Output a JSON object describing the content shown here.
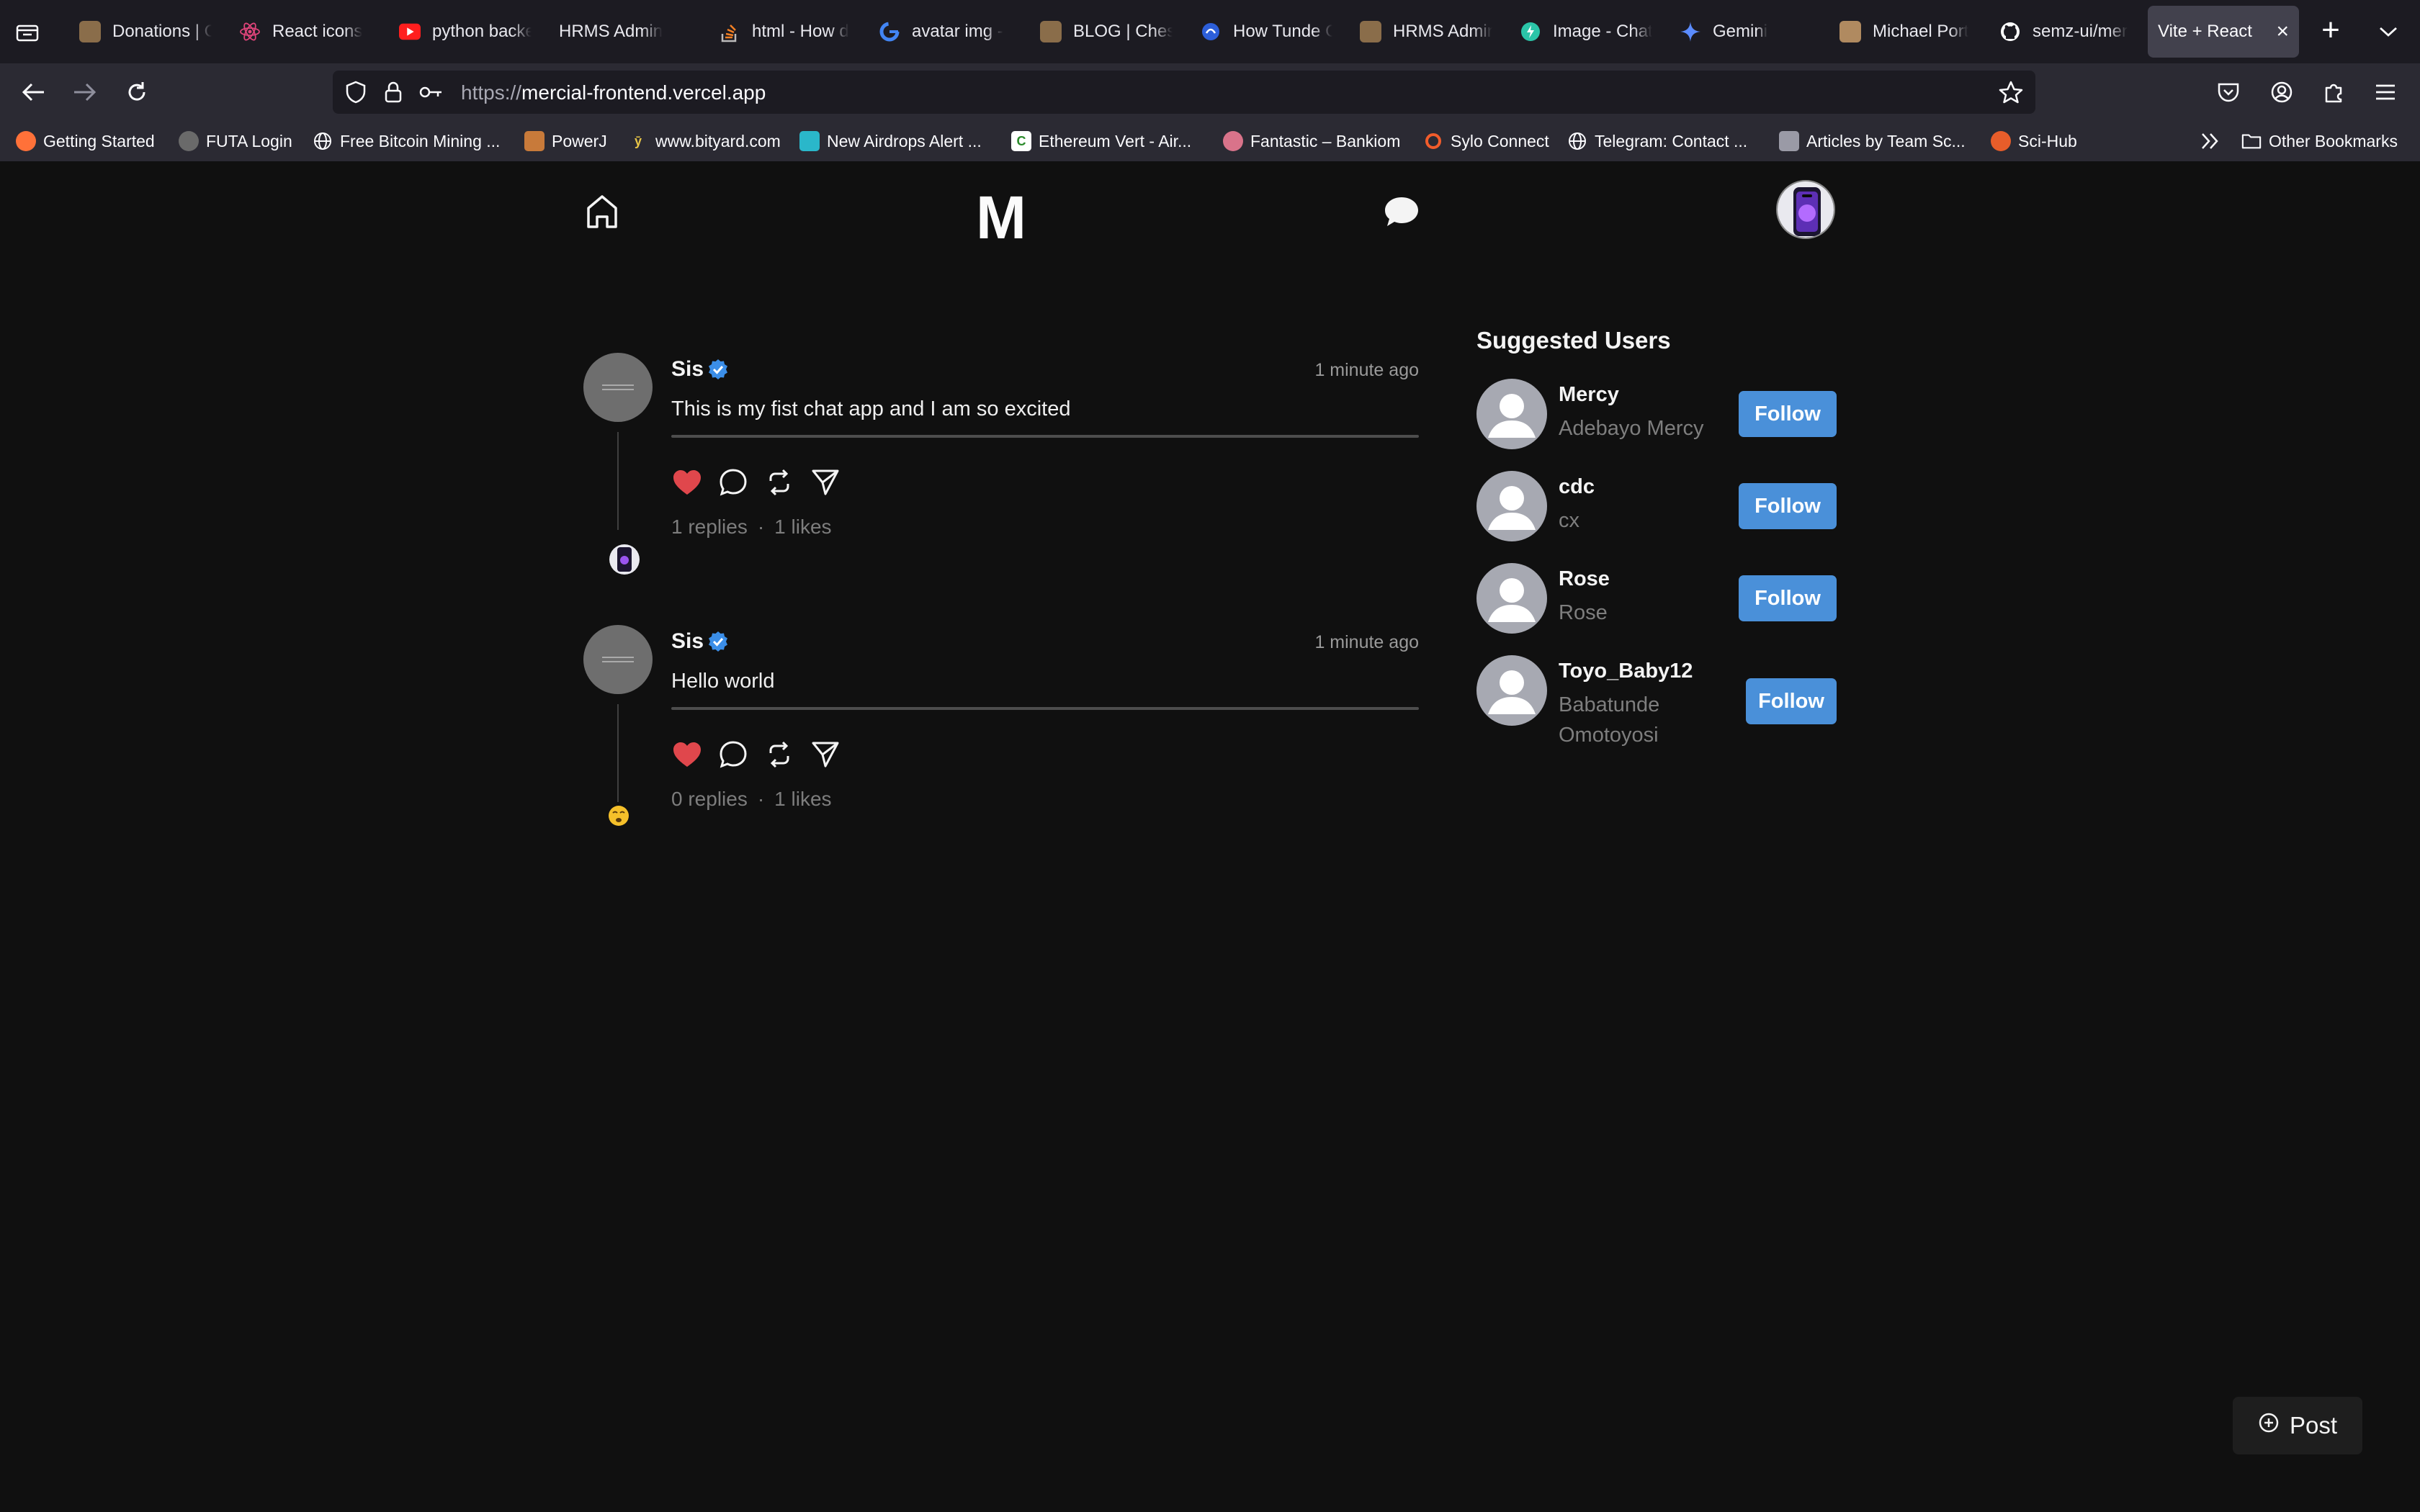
{
  "browser": {
    "tabs": [
      {
        "label": "Donations | C",
        "icon": "profile-photo-favicon",
        "color": "#8a6d4a"
      },
      {
        "label": "React icons",
        "icon": "react-favicon",
        "color": "#e0447a"
      },
      {
        "label": "python backe",
        "icon": "youtube-favicon",
        "color": "#ff1e1e"
      },
      {
        "label": "HRMS Admin",
        "icon": "none",
        "color": ""
      },
      {
        "label": "html - How d",
        "icon": "stackoverflow-favicon",
        "color": "#f48024"
      },
      {
        "label": "avatar img -",
        "icon": "google-favicon",
        "color": "#4285f4"
      },
      {
        "label": "BLOG | Ches",
        "icon": "profile-photo-favicon",
        "color": "#8a6d4a"
      },
      {
        "label": "How Tunde C",
        "icon": "blue-globe-favicon",
        "color": "#2d5fd9"
      },
      {
        "label": "HRMS Admin",
        "icon": "profile-photo-favicon",
        "color": "#8a6d4a"
      },
      {
        "label": "Image - Chat",
        "icon": "chat-favicon",
        "color": "#2bc5a8"
      },
      {
        "label": "Gemini",
        "icon": "gemini-favicon",
        "color": "#5b8cff"
      },
      {
        "label": "Michael Port",
        "icon": "profile-photo-favicon",
        "color": "#b08a60"
      },
      {
        "label": "semz-ui/mer",
        "icon": "github-favicon",
        "color": "#ffffff"
      },
      {
        "label": "Vite + React",
        "icon": "none",
        "color": "",
        "active": true
      }
    ],
    "url_scheme": "https://",
    "url_host": "mercial-frontend.vercel.app",
    "bookmarks": [
      {
        "label": "Getting Started",
        "icon": "firefox-icon",
        "color": "#ff7139"
      },
      {
        "label": "FUTA Login",
        "icon": "futa-icon",
        "color": "#6a6a6a"
      },
      {
        "label": "Free Bitcoin Mining ...",
        "icon": "globe-icon",
        "color": ""
      },
      {
        "label": "PowerJ",
        "icon": "powerj-icon",
        "color": "#c87a3a"
      },
      {
        "label": "www.bityard.com",
        "icon": "bityard-icon",
        "color": "#e8c547"
      },
      {
        "label": "New Airdrops Alert ...",
        "icon": "airdrops-icon",
        "color": "#2ab7ca"
      },
      {
        "label": "Ethereum Vert - Air...",
        "icon": "letter-c-icon",
        "color": "#ffffff"
      },
      {
        "label": "Fantastic – Bankiom",
        "icon": "bankiom-icon",
        "color": "#d9738a"
      },
      {
        "label": "Sylo Connect",
        "icon": "sylo-icon",
        "color": "#f25c2b"
      },
      {
        "label": "Telegram: Contact ...",
        "icon": "globe-icon",
        "color": ""
      },
      {
        "label": "Articles by Team Sc...",
        "icon": "teamsc-icon",
        "color": "#9a9aa6"
      },
      {
        "label": "Sci-Hub",
        "icon": "scihub-icon",
        "color": "#e85d2a"
      }
    ],
    "other_bookmarks": "Other Bookmarks"
  },
  "app": {
    "logo": "M",
    "posts": [
      {
        "username": "Sis",
        "time": "1 minute ago",
        "text": "This is my fist chat app and I am so excited",
        "replies": "1 replies",
        "likes": "1 likes",
        "separator": "·"
      },
      {
        "username": "Sis",
        "time": "1 minute ago",
        "text": "Hello world",
        "replies": "0 replies",
        "likes": "1 likes",
        "separator": "·"
      }
    ],
    "suggested_title": "Suggested Users",
    "suggested_users": [
      {
        "name": "Mercy",
        "handle": "Adebayo Mercy",
        "button": "Follow"
      },
      {
        "name": "cdc",
        "handle": "cx",
        "button": "Follow"
      },
      {
        "name": "Rose",
        "handle": "Rose",
        "button": "Follow"
      },
      {
        "name": "Toyo_Baby12",
        "handle": "Babatunde Omotoyosi",
        "button": "Follow"
      }
    ],
    "post_button": "Post",
    "colors": {
      "background": "#101010",
      "follow_button": "#4a90d9",
      "like_heart": "#e0474c",
      "verified_badge": "#3b8ee8"
    }
  }
}
